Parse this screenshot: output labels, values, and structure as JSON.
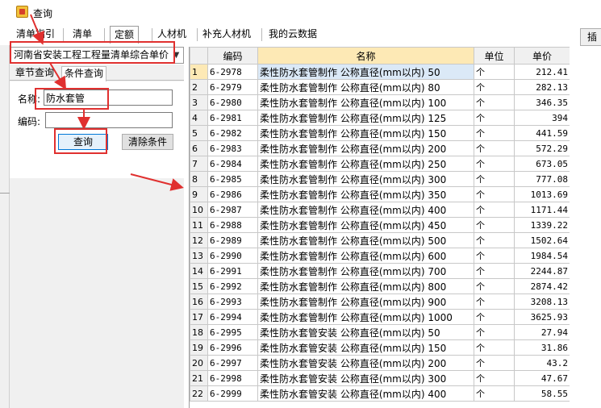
{
  "window": {
    "title": "查询"
  },
  "tabs": [
    {
      "label": "清单指引"
    },
    {
      "label": "清单"
    },
    {
      "label": "定额"
    },
    {
      "label": "人材机"
    },
    {
      "label": "补充人材机"
    },
    {
      "label": "我的云数据"
    }
  ],
  "right_button_label": "插",
  "library": {
    "selected": "河南省安装工程工程量清单综合单价"
  },
  "subtabs": [
    {
      "label": "章节查询"
    },
    {
      "label": "条件查询"
    }
  ],
  "form": {
    "name_label": "名称:",
    "name_value": "防水套管",
    "code_label": "编码:",
    "code_value": "",
    "query_button": "查询",
    "clear_button": "清除条件"
  },
  "table": {
    "columns": [
      "",
      "编码",
      "名称",
      "单位",
      "单价"
    ],
    "rows": [
      {
        "no": "1",
        "code": "6-2978",
        "name": "柔性防水套管制作 公称直径(mm以内) 50",
        "unit": "个",
        "price": "212.41"
      },
      {
        "no": "2",
        "code": "6-2979",
        "name": "柔性防水套管制作 公称直径(mm以内) 80",
        "unit": "个",
        "price": "282.13"
      },
      {
        "no": "3",
        "code": "6-2980",
        "name": "柔性防水套管制作 公称直径(mm以内) 100",
        "unit": "个",
        "price": "346.35"
      },
      {
        "no": "4",
        "code": "6-2981",
        "name": "柔性防水套管制作 公称直径(mm以内) 125",
        "unit": "个",
        "price": "394"
      },
      {
        "no": "5",
        "code": "6-2982",
        "name": "柔性防水套管制作 公称直径(mm以内) 150",
        "unit": "个",
        "price": "441.59"
      },
      {
        "no": "6",
        "code": "6-2983",
        "name": "柔性防水套管制作 公称直径(mm以内) 200",
        "unit": "个",
        "price": "572.29"
      },
      {
        "no": "7",
        "code": "6-2984",
        "name": "柔性防水套管制作 公称直径(mm以内) 250",
        "unit": "个",
        "price": "673.05"
      },
      {
        "no": "8",
        "code": "6-2985",
        "name": "柔性防水套管制作 公称直径(mm以内) 300",
        "unit": "个",
        "price": "777.08"
      },
      {
        "no": "9",
        "code": "6-2986",
        "name": "柔性防水套管制作 公称直径(mm以内) 350",
        "unit": "个",
        "price": "1013.69"
      },
      {
        "no": "10",
        "code": "6-2987",
        "name": "柔性防水套管制作 公称直径(mm以内) 400",
        "unit": "个",
        "price": "1171.44"
      },
      {
        "no": "11",
        "code": "6-2988",
        "name": "柔性防水套管制作 公称直径(mm以内) 450",
        "unit": "个",
        "price": "1339.22"
      },
      {
        "no": "12",
        "code": "6-2989",
        "name": "柔性防水套管制作 公称直径(mm以内) 500",
        "unit": "个",
        "price": "1502.64"
      },
      {
        "no": "13",
        "code": "6-2990",
        "name": "柔性防水套管制作 公称直径(mm以内) 600",
        "unit": "个",
        "price": "1984.54"
      },
      {
        "no": "14",
        "code": "6-2991",
        "name": "柔性防水套管制作 公称直径(mm以内) 700",
        "unit": "个",
        "price": "2244.87"
      },
      {
        "no": "15",
        "code": "6-2992",
        "name": "柔性防水套管制作 公称直径(mm以内) 800",
        "unit": "个",
        "price": "2874.42"
      },
      {
        "no": "16",
        "code": "6-2993",
        "name": "柔性防水套管制作 公称直径(mm以内) 900",
        "unit": "个",
        "price": "3208.13"
      },
      {
        "no": "17",
        "code": "6-2994",
        "name": "柔性防水套管制作 公称直径(mm以内) 1000",
        "unit": "个",
        "price": "3625.93"
      },
      {
        "no": "18",
        "code": "6-2995",
        "name": "柔性防水套管安装 公称直径(mm以内) 50",
        "unit": "个",
        "price": "27.94"
      },
      {
        "no": "19",
        "code": "6-2996",
        "name": "柔性防水套管安装 公称直径(mm以内) 150",
        "unit": "个",
        "price": "31.86"
      },
      {
        "no": "20",
        "code": "6-2997",
        "name": "柔性防水套管安装 公称直径(mm以内) 200",
        "unit": "个",
        "price": "43.2"
      },
      {
        "no": "21",
        "code": "6-2998",
        "name": "柔性防水套管安装 公称直径(mm以内) 300",
        "unit": "个",
        "price": "47.67"
      },
      {
        "no": "22",
        "code": "6-2999",
        "name": "柔性防水套管安装 公称直径(mm以内) 400",
        "unit": "个",
        "price": "58.55"
      }
    ]
  },
  "colors": {
    "annotation": "#e0302f",
    "selected_row": "#fde9b5",
    "selected_cell": "#dbe9f7"
  }
}
